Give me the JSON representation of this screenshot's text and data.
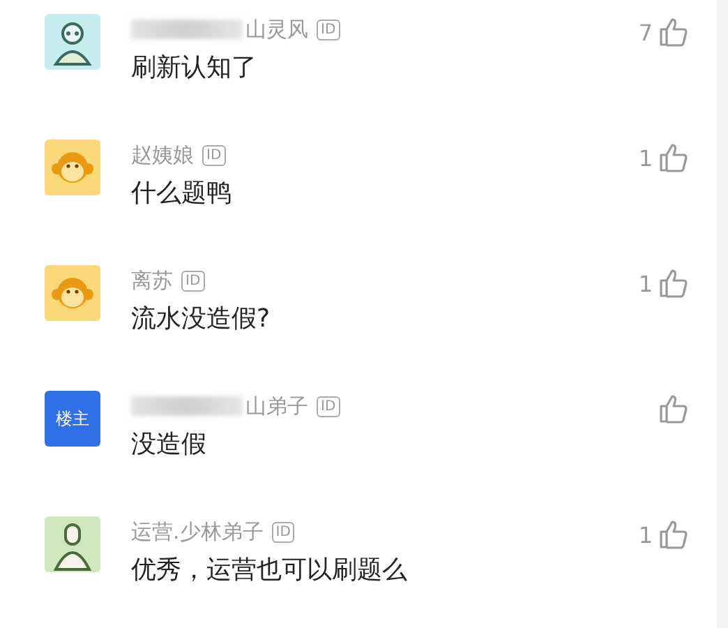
{
  "comments": [
    {
      "avatar": {
        "kind": "coder"
      },
      "name_hidden": true,
      "name": "山灵风",
      "id_badge": "ID",
      "text": "刷新认知了",
      "likes": "7"
    },
    {
      "avatar": {
        "kind": "monkey"
      },
      "name_hidden": false,
      "name": "赵姨娘",
      "id_badge": "ID",
      "text": "什么题鸭",
      "likes": "1"
    },
    {
      "avatar": {
        "kind": "monkey"
      },
      "name_hidden": false,
      "name": "离苏",
      "id_badge": "ID",
      "text": "流水没造假?",
      "likes": "1"
    },
    {
      "avatar": {
        "kind": "owner",
        "label": "楼主"
      },
      "name_hidden": true,
      "name": "山弟子",
      "id_badge": "ID",
      "text": "没造假"
    },
    {
      "avatar": {
        "kind": "operator"
      },
      "name_hidden": false,
      "name": "运营.少林弟子",
      "id_badge": "ID",
      "text": "优秀，运营也可以刷题么",
      "likes": "1"
    }
  ]
}
